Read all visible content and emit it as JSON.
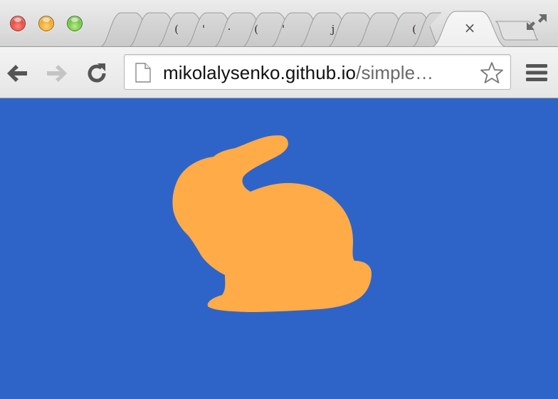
{
  "window": {
    "controls": [
      "close",
      "minimize",
      "zoom"
    ],
    "fullscreen_icon": "fullscreen-arrows-icon"
  },
  "tabs": {
    "background_tab_glyphs": [
      "(",
      "'",
      "·",
      "(",
      "'",
      "j",
      "("
    ],
    "active_tab_close": "×",
    "new_tab_icon": "new-tab-icon"
  },
  "toolbar": {
    "back_icon": "back-arrow-icon",
    "forward_icon": "forward-arrow-icon",
    "forward_enabled": false,
    "reload_icon": "reload-icon",
    "menu_icon": "hamburger-menu-icon"
  },
  "omnibox": {
    "page_icon": "page-icon",
    "url_host": "mikolalysenko.github.io",
    "url_path": "/simple…",
    "bookmark_icon": "star-icon"
  },
  "content": {
    "background_color": "#2e64c8",
    "shape_color": "#ffab47",
    "shape": "bunny-silhouette"
  }
}
